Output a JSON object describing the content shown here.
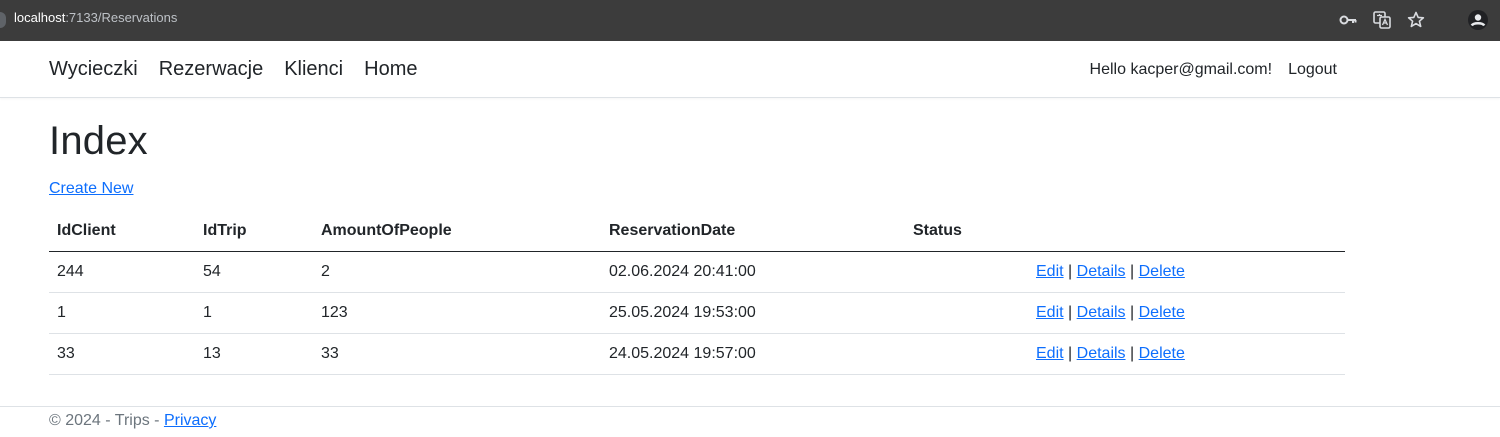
{
  "browser": {
    "url_host": "localhost",
    "url_path": ":7133/Reservations",
    "icons": [
      "key-icon",
      "translate-icon",
      "star-icon",
      "profile-icon"
    ]
  },
  "navbar": {
    "links": [
      "Wycieczki",
      "Rezerwacje",
      "Klienci",
      "Home"
    ],
    "greeting": "Hello kacper@gmail.com!",
    "logout": "Logout"
  },
  "page": {
    "title": "Index",
    "create_new": "Create New"
  },
  "table": {
    "headers": [
      "IdClient",
      "IdTrip",
      "AmountOfPeople",
      "ReservationDate",
      "Status"
    ],
    "rows": [
      {
        "id_client": "244",
        "id_trip": "54",
        "amount": "2",
        "date": "02.06.2024 20:41:00",
        "status": ""
      },
      {
        "id_client": "1",
        "id_trip": "1",
        "amount": "123",
        "date": "25.05.2024 19:53:00",
        "status": ""
      },
      {
        "id_client": "33",
        "id_trip": "13",
        "amount": "33",
        "date": "24.05.2024 19:57:00",
        "status": ""
      }
    ],
    "actions": {
      "edit": "Edit",
      "details": "Details",
      "delete": "Delete",
      "separator": "|"
    }
  },
  "footer": {
    "text": "© 2024 - Trips - ",
    "privacy": "Privacy"
  },
  "colors": {
    "link": "#0d6efd",
    "text": "#212529",
    "muted": "#6c757d",
    "chrome_bg": "#3c3c3c"
  }
}
